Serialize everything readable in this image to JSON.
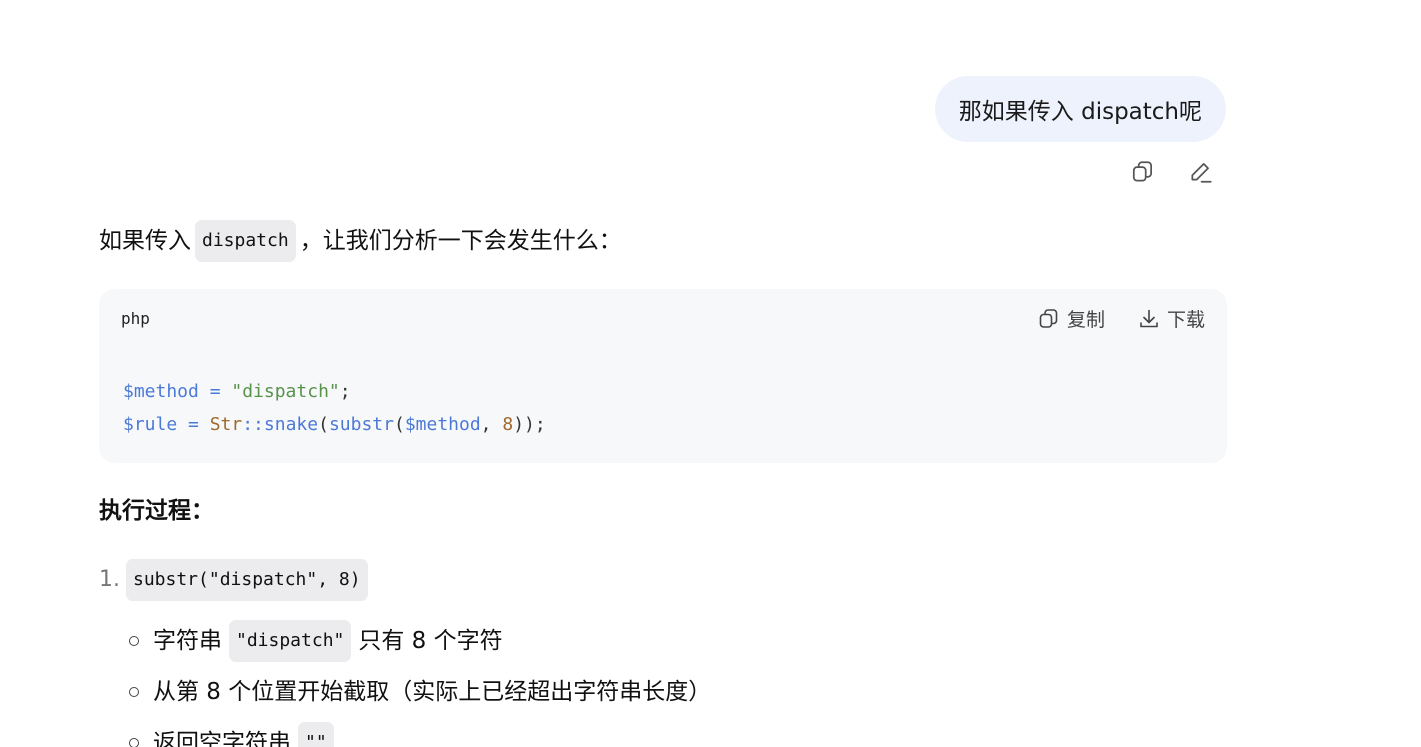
{
  "user_message": {
    "text": "那如果传入 dispatch呢"
  },
  "user_actions": {
    "copy_icon": "copy-icon",
    "edit_icon": "pencil-icon"
  },
  "reply": {
    "intro_before": "如果传入",
    "intro_code": "dispatch",
    "intro_after": "，让我们分析一下会发生什么："
  },
  "code_block": {
    "language": "php",
    "copy_label": "复制",
    "download_label": "下载",
    "line1": {
      "var": "$method",
      "op": " = ",
      "str": "\"dispatch\"",
      "end": ";"
    },
    "line2": {
      "var": "$rule",
      "op": " = ",
      "cls": "Str",
      "sep": "::",
      "fn1": "snake",
      "p1": "(",
      "fn2": "substr",
      "p2": "(",
      "arg": "$method",
      "comma": ", ",
      "num": "8",
      "end": "));"
    }
  },
  "section": {
    "title": "执行过程："
  },
  "steps": [
    {
      "number": "1.",
      "code": "substr(\"dispatch\", 8)",
      "sub": [
        {
          "before": "字符串",
          "code": "\"dispatch\"",
          "after": "只有 8 个字符"
        },
        {
          "text": "从第 8 个位置开始截取（实际上已经超出字符串长度）"
        },
        {
          "before": "返回空字符串",
          "code": "\"\""
        }
      ]
    }
  ],
  "colors": {
    "user_bubble": "#eef2fd",
    "code_bg": "#f7f8fa",
    "variable": "#4d79d6",
    "string": "#59924a",
    "class_number": "#a0692b"
  }
}
